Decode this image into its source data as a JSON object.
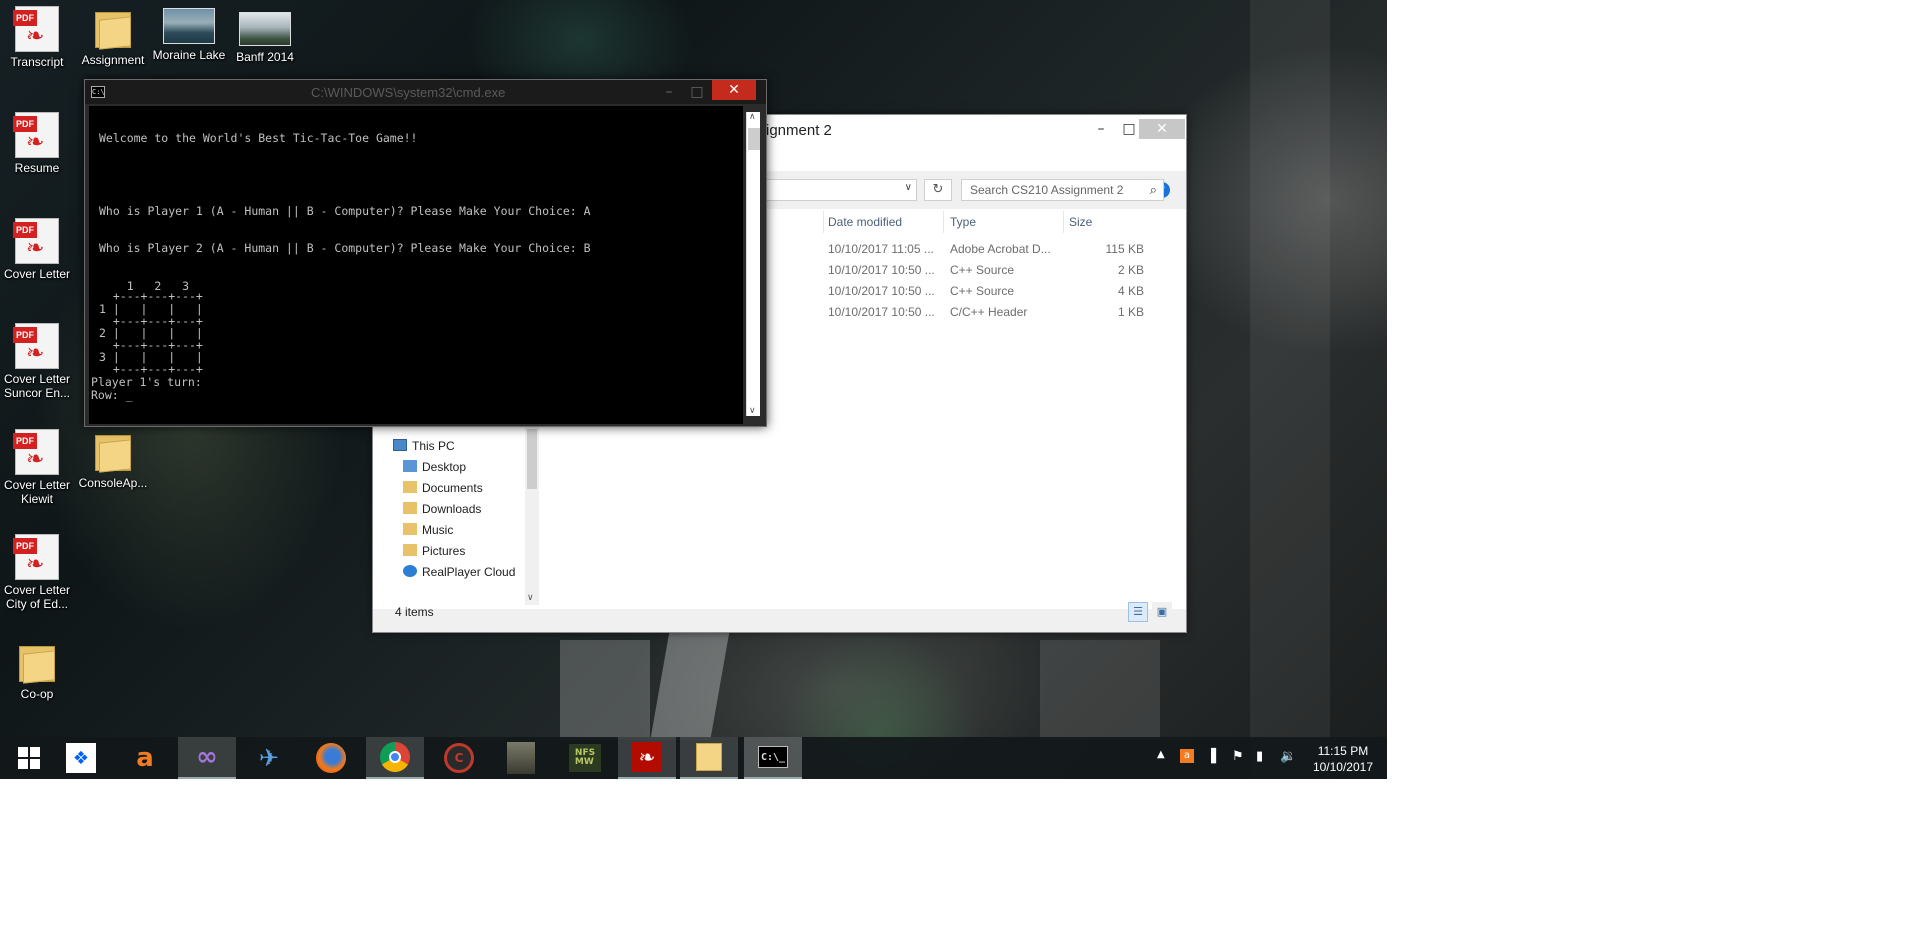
{
  "desktop_icons": [
    {
      "label": "Transcript",
      "type": "pdf"
    },
    {
      "label": "Assignment",
      "type": "folder"
    },
    {
      "label": "Moraine Lake",
      "type": "image"
    },
    {
      "label": "Banff 2014",
      "type": "image"
    },
    {
      "label": "Resume",
      "type": "pdf"
    },
    {
      "label": "Cover Letter",
      "type": "pdf"
    },
    {
      "label": "Cover Letter Suncor En...",
      "type": "pdf"
    },
    {
      "label": "Cover Letter Kiewit",
      "type": "pdf"
    },
    {
      "label": "ConsoleAp...",
      "type": "folder"
    },
    {
      "label": "Cover Letter City of Ed...",
      "type": "pdf"
    },
    {
      "label": "Co-op",
      "type": "folder"
    }
  ],
  "explorer": {
    "title": "ssignment 2",
    "search_placeholder": "Search CS210 Assignment 2",
    "columns": {
      "date": "Date modified",
      "type": "Type",
      "size": "Size"
    },
    "files": [
      {
        "date": "10/10/2017 11:05 ...",
        "type": "Adobe Acrobat D...",
        "size": "115 KB"
      },
      {
        "date": "10/10/2017 10:50 ...",
        "type": "C++ Source",
        "size": "2 KB"
      },
      {
        "date": "10/10/2017 10:50 ...",
        "type": "C++ Source",
        "size": "4 KB"
      },
      {
        "date": "10/10/2017 10:50 ...",
        "type": "C/C++ Header",
        "size": "1 KB"
      }
    ],
    "nav": {
      "this_pc": "This PC",
      "items": [
        "Desktop",
        "Documents",
        "Downloads",
        "Music",
        "Pictures",
        "RealPlayer Cloud"
      ]
    },
    "status": "4 items"
  },
  "cmd": {
    "title": "C:\\WINDOWS\\system32\\cmd.exe",
    "lines": [
      "Welcome to the World's Best Tic-Tac-Toe Game!!",
      "Who is Player 1 (A - Human || B - Computer)? Please Make Your Choice: A",
      "Who is Player 2 (A - Human || B - Computer)? Please Make Your Choice: B",
      "    1   2   3",
      "  +---+---+---+",
      "1 |   |   |   |",
      "  +---+---+---+",
      "2 |   |   |   |",
      "  +---+---+---+",
      "3 |   |   |   |",
      "  +---+---+---+",
      "Player 1's turn:",
      "Row: _"
    ]
  },
  "taskbar": {
    "apps": [
      "start",
      "dropbox",
      "avast",
      "visual-studio",
      "xming",
      "firefox",
      "chrome",
      "ccleaner",
      "game-character",
      "nfs-mw",
      "acrobat",
      "file-explorer",
      "cmd"
    ],
    "time": "11:15 PM",
    "date": "10/10/2017"
  }
}
